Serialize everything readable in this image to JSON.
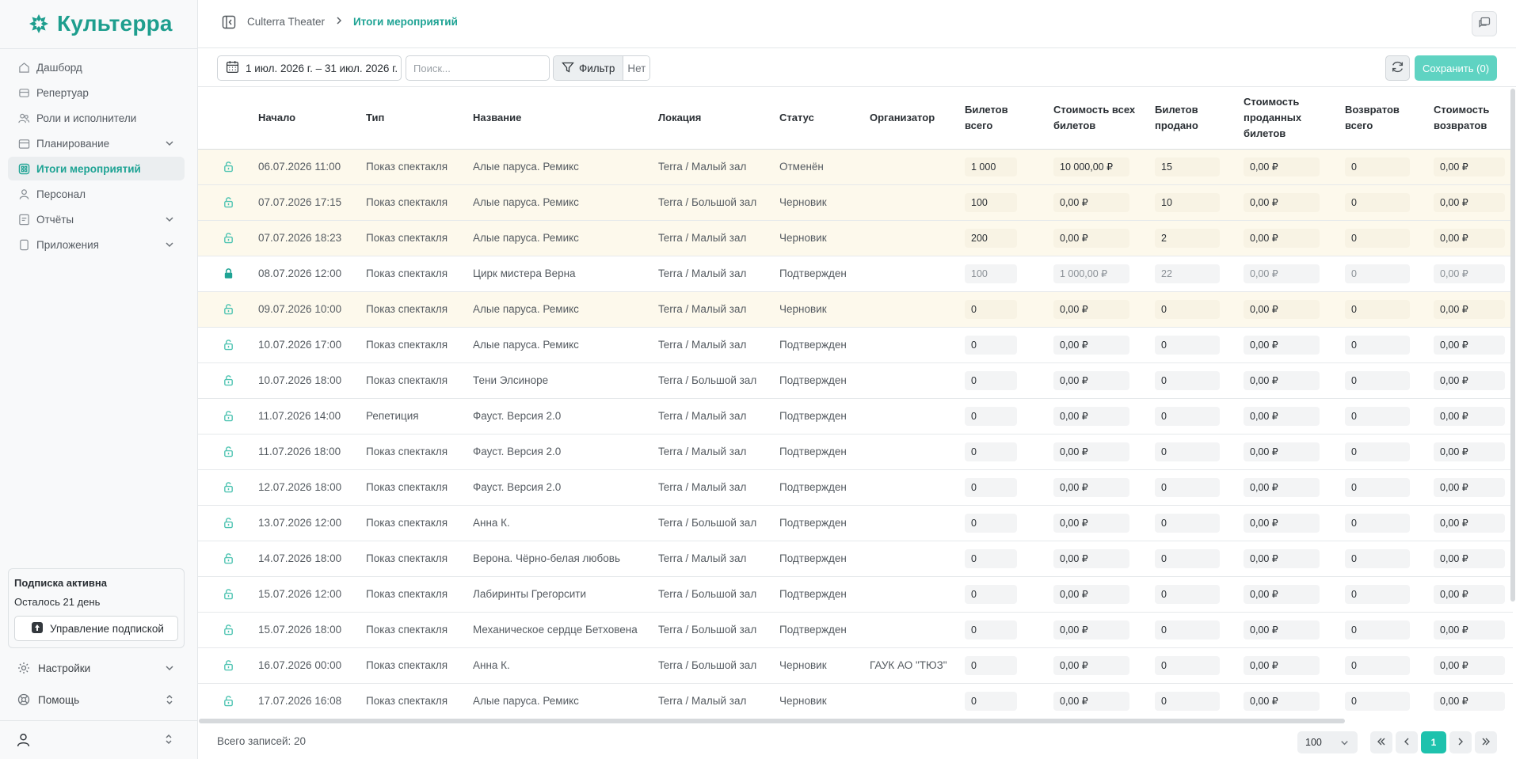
{
  "app": {
    "logo_text": "Культерра",
    "brand_color": "#1e9e8e",
    "accent_color": "#1ea394"
  },
  "sidebar": {
    "items": [
      {
        "label": "Дашборд",
        "icon": "home-icon"
      },
      {
        "label": "Репертуар",
        "icon": "theater-icon"
      },
      {
        "label": "Роли и исполнители",
        "icon": "users-icon"
      },
      {
        "label": "Планирование",
        "icon": "calendar-icon",
        "expandable": true
      },
      {
        "label": "Итоги мероприятий",
        "icon": "results-icon",
        "active": true
      },
      {
        "label": "Персонал",
        "icon": "person-icon"
      },
      {
        "label": "Отчёты",
        "icon": "report-icon",
        "expandable": true
      },
      {
        "label": "Приложения",
        "icon": "apps-icon",
        "expandable": true
      }
    ],
    "subscription": {
      "title": "Подписка активна",
      "days_left": "Осталось 21 день",
      "manage_label": "Управление подпиской"
    },
    "settings_label": "Настройки",
    "help_label": "Помощь"
  },
  "header": {
    "breadcrumb": [
      "Culterra Theater",
      "Итоги мероприятий"
    ]
  },
  "toolbar": {
    "date_range": "1 июл. 2026 г. – 31 июл. 2026 г.",
    "search_placeholder": "Поиск...",
    "filter_label": "Фильтр",
    "filter_value": "Нет",
    "save_label": "Сохранить (0)"
  },
  "table": {
    "columns": [
      "",
      "Начало",
      "Тип",
      "Название",
      "Локация",
      "Статус",
      "Организатор",
      "Билетов всего",
      "Стоимость всех билетов",
      "Билетов продано",
      "Стоимость проданных билетов",
      "Возвратов всего",
      "Стоимость возвратов"
    ],
    "rows": [
      {
        "lock": "unlocked",
        "highlight": true,
        "start": "06.07.2026 11:00",
        "type": "Показ спектакля",
        "name": "Алые паруса. Ремикс",
        "location": "Terra / Малый зал",
        "status": "Отменён",
        "organizer": "",
        "tickets_total": "1 000",
        "cost_total": "10 000,00 ₽",
        "tickets_sold": "15",
        "cost_sold": "0,00 ₽",
        "returns_total": "0",
        "cost_returns": "0,00 ₽"
      },
      {
        "lock": "unlocked",
        "highlight": true,
        "start": "07.07.2026 17:15",
        "type": "Показ спектакля",
        "name": "Алые паруса. Ремикс",
        "location": "Terra / Большой зал",
        "status": "Черновик",
        "organizer": "",
        "tickets_total": "100",
        "cost_total": "0,00 ₽",
        "tickets_sold": "10",
        "cost_sold": "0,00 ₽",
        "returns_total": "0",
        "cost_returns": "0,00 ₽"
      },
      {
        "lock": "unlocked",
        "highlight": true,
        "start": "07.07.2026 18:23",
        "type": "Показ спектакля",
        "name": "Алые паруса. Ремикс",
        "location": "Terra / Малый зал",
        "status": "Черновик",
        "organizer": "",
        "tickets_total": "200",
        "cost_total": "0,00 ₽",
        "tickets_sold": "2",
        "cost_sold": "0,00 ₽",
        "returns_total": "0",
        "cost_returns": "0,00 ₽"
      },
      {
        "lock": "locked",
        "highlight": false,
        "start": "08.07.2026 12:00",
        "type": "Показ спектакля",
        "name": "Цирк мистера Верна",
        "location": "Terra / Малый зал",
        "status": "Подтвержден",
        "organizer": "",
        "tickets_total": "100",
        "cost_total": "1 000,00 ₽",
        "tickets_sold": "22",
        "cost_sold": "0,00 ₽",
        "returns_total": "0",
        "cost_returns": "0,00 ₽"
      },
      {
        "lock": "unlocked",
        "highlight": true,
        "start": "09.07.2026 10:00",
        "type": "Показ спектакля",
        "name": "Алые паруса. Ремикс",
        "location": "Terra / Малый зал",
        "status": "Черновик",
        "organizer": "",
        "tickets_total": "0",
        "cost_total": "0,00 ₽",
        "tickets_sold": "0",
        "cost_sold": "0,00 ₽",
        "returns_total": "0",
        "cost_returns": "0,00 ₽"
      },
      {
        "lock": "unlocked",
        "highlight": false,
        "start": "10.07.2026 17:00",
        "type": "Показ спектакля",
        "name": "Алые паруса. Ремикс",
        "location": "Terra / Малый зал",
        "status": "Подтвержден",
        "organizer": "",
        "tickets_total": "0",
        "cost_total": "0,00 ₽",
        "tickets_sold": "0",
        "cost_sold": "0,00 ₽",
        "returns_total": "0",
        "cost_returns": "0,00 ₽"
      },
      {
        "lock": "unlocked",
        "highlight": false,
        "start": "10.07.2026 18:00",
        "type": "Показ спектакля",
        "name": "Тени Элсиноре",
        "location": "Terra / Большой зал",
        "status": "Подтвержден",
        "organizer": "",
        "tickets_total": "0",
        "cost_total": "0,00 ₽",
        "tickets_sold": "0",
        "cost_sold": "0,00 ₽",
        "returns_total": "0",
        "cost_returns": "0,00 ₽"
      },
      {
        "lock": "unlocked",
        "highlight": false,
        "start": "11.07.2026 14:00",
        "type": "Репетиция",
        "name": "Фауст. Версия 2.0",
        "location": "Terra / Малый зал",
        "status": "Подтвержден",
        "organizer": "",
        "tickets_total": "0",
        "cost_total": "0,00 ₽",
        "tickets_sold": "0",
        "cost_sold": "0,00 ₽",
        "returns_total": "0",
        "cost_returns": "0,00 ₽"
      },
      {
        "lock": "unlocked",
        "highlight": false,
        "start": "11.07.2026 18:00",
        "type": "Показ спектакля",
        "name": "Фауст. Версия 2.0",
        "location": "Terra / Малый зал",
        "status": "Подтвержден",
        "organizer": "",
        "tickets_total": "0",
        "cost_total": "0,00 ₽",
        "tickets_sold": "0",
        "cost_sold": "0,00 ₽",
        "returns_total": "0",
        "cost_returns": "0,00 ₽"
      },
      {
        "lock": "unlocked",
        "highlight": false,
        "start": "12.07.2026 18:00",
        "type": "Показ спектакля",
        "name": "Фауст. Версия 2.0",
        "location": "Terra / Малый зал",
        "status": "Подтвержден",
        "organizer": "",
        "tickets_total": "0",
        "cost_total": "0,00 ₽",
        "tickets_sold": "0",
        "cost_sold": "0,00 ₽",
        "returns_total": "0",
        "cost_returns": "0,00 ₽"
      },
      {
        "lock": "unlocked",
        "highlight": false,
        "start": "13.07.2026 12:00",
        "type": "Показ спектакля",
        "name": "Анна К.",
        "location": "Terra / Большой зал",
        "status": "Подтвержден",
        "organizer": "",
        "tickets_total": "0",
        "cost_total": "0,00 ₽",
        "tickets_sold": "0",
        "cost_sold": "0,00 ₽",
        "returns_total": "0",
        "cost_returns": "0,00 ₽"
      },
      {
        "lock": "unlocked",
        "highlight": false,
        "start": "14.07.2026 18:00",
        "type": "Показ спектакля",
        "name": "Верона. Чёрно-белая любовь",
        "location": "Terra / Малый зал",
        "status": "Подтвержден",
        "organizer": "",
        "tickets_total": "0",
        "cost_total": "0,00 ₽",
        "tickets_sold": "0",
        "cost_sold": "0,00 ₽",
        "returns_total": "0",
        "cost_returns": "0,00 ₽"
      },
      {
        "lock": "unlocked",
        "highlight": false,
        "start": "15.07.2026 12:00",
        "type": "Показ спектакля",
        "name": "Лабиринты Грегорсити",
        "location": "Terra / Большой зал",
        "status": "Подтвержден",
        "organizer": "",
        "tickets_total": "0",
        "cost_total": "0,00 ₽",
        "tickets_sold": "0",
        "cost_sold": "0,00 ₽",
        "returns_total": "0",
        "cost_returns": "0,00 ₽"
      },
      {
        "lock": "unlocked",
        "highlight": false,
        "start": "15.07.2026 18:00",
        "type": "Показ спектакля",
        "name": "Механическое сердце Бетховена",
        "location": "Terra / Большой зал",
        "status": "Подтвержден",
        "organizer": "",
        "tickets_total": "0",
        "cost_total": "0,00 ₽",
        "tickets_sold": "0",
        "cost_sold": "0,00 ₽",
        "returns_total": "0",
        "cost_returns": "0,00 ₽"
      },
      {
        "lock": "unlocked",
        "highlight": false,
        "start": "16.07.2026 00:00",
        "type": "Показ спектакля",
        "name": "Анна К.",
        "location": "Terra / Большой зал",
        "status": "Черновик",
        "organizer": "ГАУК АО \"ТЮЗ\"",
        "tickets_total": "0",
        "cost_total": "0,00 ₽",
        "tickets_sold": "0",
        "cost_sold": "0,00 ₽",
        "returns_total": "0",
        "cost_returns": "0,00 ₽"
      },
      {
        "lock": "unlocked",
        "highlight": false,
        "start": "17.07.2026 16:08",
        "type": "Показ спектакля",
        "name": "Алые паруса. Ремикс",
        "location": "Terra / Малый зал",
        "status": "Черновик",
        "organizer": "",
        "tickets_total": "0",
        "cost_total": "0,00 ₽",
        "tickets_sold": "0",
        "cost_sold": "0,00 ₽",
        "returns_total": "0",
        "cost_returns": "0,00 ₽"
      }
    ]
  },
  "footer": {
    "total_label": "Всего записей: 20",
    "page_size": "100",
    "current_page": "1"
  }
}
